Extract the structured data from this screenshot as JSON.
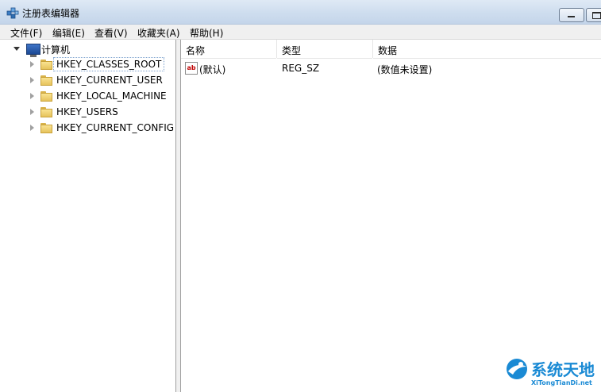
{
  "window": {
    "title": "注册表编辑器"
  },
  "menu": [
    "文件(F)",
    "编辑(E)",
    "查看(V)",
    "收藏夹(A)",
    "帮助(H)"
  ],
  "tree": {
    "root": "计算机",
    "keys": [
      "HKEY_CLASSES_ROOT",
      "HKEY_CURRENT_USER",
      "HKEY_LOCAL_MACHINE",
      "HKEY_USERS",
      "HKEY_CURRENT_CONFIG"
    ],
    "selected": "HKEY_CLASSES_ROOT"
  },
  "list": {
    "columns": [
      "名称",
      "类型",
      "数据"
    ],
    "rows": [
      {
        "name": "(默认)",
        "type": "REG_SZ",
        "data": "(数值未设置)",
        "icon": "ab-string-icon"
      }
    ]
  },
  "watermark": {
    "title": "系统天地",
    "url": "XiTongTianDi.net"
  }
}
